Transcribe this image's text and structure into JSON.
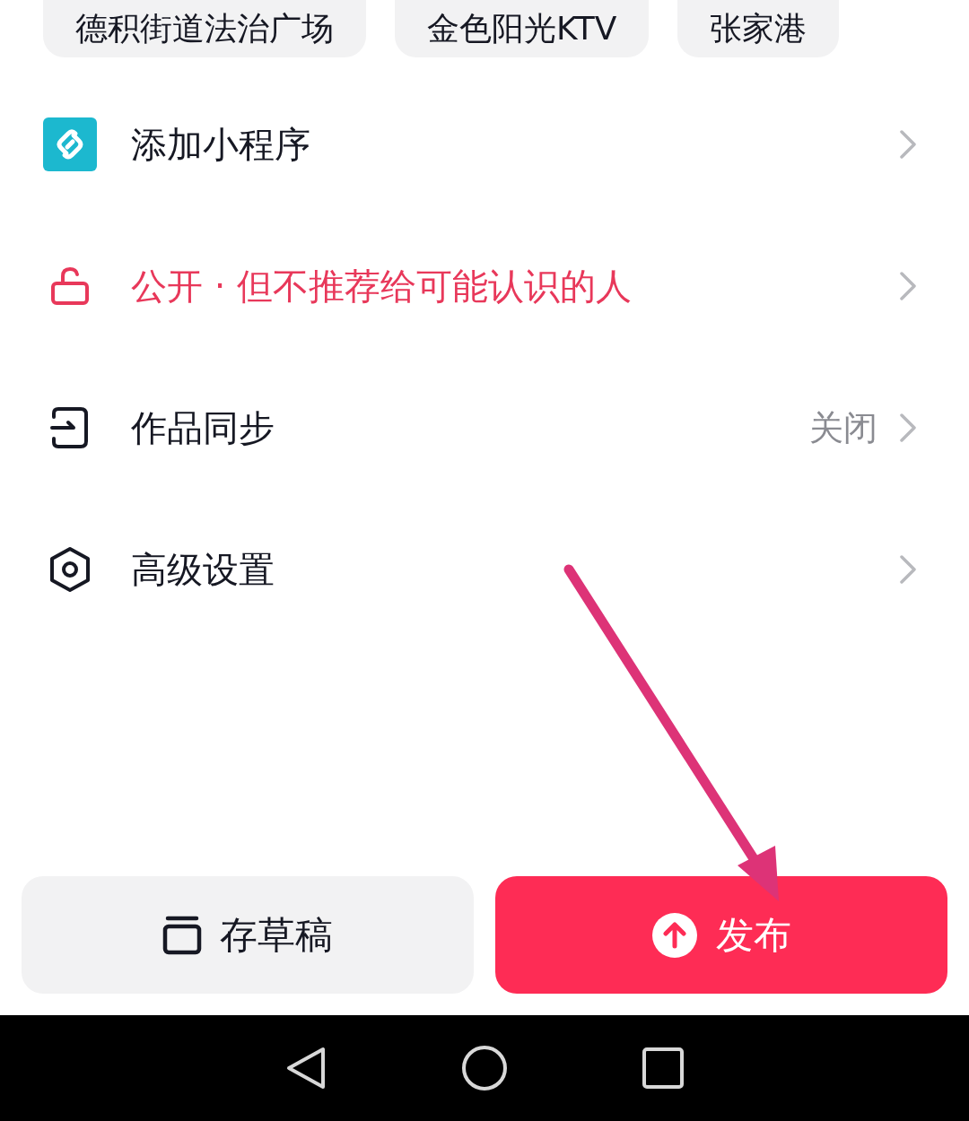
{
  "location_chips": [
    "德积街道法治广场",
    "金色阳光KTV",
    "张家港"
  ],
  "settings": [
    {
      "kind": "mini-program",
      "label": "添加小程序",
      "color": "#161823"
    },
    {
      "kind": "lock",
      "label": "公开 · 但不推荐给可能认识的人",
      "color": "#e8385a"
    },
    {
      "kind": "sync",
      "label": "作品同步",
      "value": "关闭",
      "color": "#161823"
    },
    {
      "kind": "settings",
      "label": "高级设置",
      "color": "#161823"
    }
  ],
  "draft_button": "存草稿",
  "publish_button": "发布"
}
